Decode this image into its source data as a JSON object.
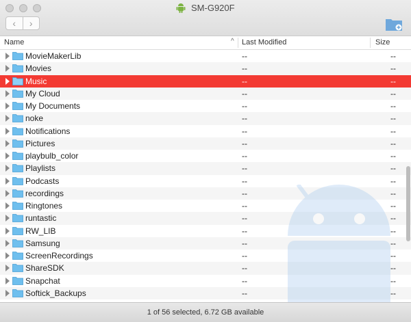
{
  "window": {
    "title": "SM-G920F"
  },
  "columns": {
    "name": "Name",
    "modified": "Last Modified",
    "size": "Size"
  },
  "rows": [
    {
      "name": "MovieMakerLib",
      "modified": "--",
      "size": "--"
    },
    {
      "name": "Movies",
      "modified": "--",
      "size": "--"
    },
    {
      "name": "Music",
      "modified": "--",
      "size": "--",
      "selected": true
    },
    {
      "name": "My Cloud",
      "modified": "--",
      "size": "--"
    },
    {
      "name": "My Documents",
      "modified": "--",
      "size": "--"
    },
    {
      "name": "noke",
      "modified": "--",
      "size": "--"
    },
    {
      "name": "Notifications",
      "modified": "--",
      "size": "--"
    },
    {
      "name": "Pictures",
      "modified": "--",
      "size": "--"
    },
    {
      "name": "playbulb_color",
      "modified": "--",
      "size": "--"
    },
    {
      "name": "Playlists",
      "modified": "--",
      "size": "--"
    },
    {
      "name": "Podcasts",
      "modified": "--",
      "size": "--"
    },
    {
      "name": "recordings",
      "modified": "--",
      "size": "--"
    },
    {
      "name": "Ringtones",
      "modified": "--",
      "size": "--"
    },
    {
      "name": "runtastic",
      "modified": "--",
      "size": "--"
    },
    {
      "name": "RW_LIB",
      "modified": "--",
      "size": "--"
    },
    {
      "name": "Samsung",
      "modified": "--",
      "size": "--"
    },
    {
      "name": "ScreenRecordings",
      "modified": "--",
      "size": "--"
    },
    {
      "name": "ShareSDK",
      "modified": "--",
      "size": "--"
    },
    {
      "name": "Snapchat",
      "modified": "--",
      "size": "--"
    },
    {
      "name": "Softick_Backups",
      "modified": "--",
      "size": "--"
    }
  ],
  "status": {
    "text": "1 of 56 selected, 6.72 GB available"
  },
  "colors": {
    "selection": "#f33a33",
    "folder": "#6fbfee",
    "android": "#a4c8ee"
  },
  "icons": {
    "back": "chevron-left-icon",
    "forward": "chevron-right-icon",
    "new_folder": "new-folder-icon",
    "device": "android-icon"
  }
}
